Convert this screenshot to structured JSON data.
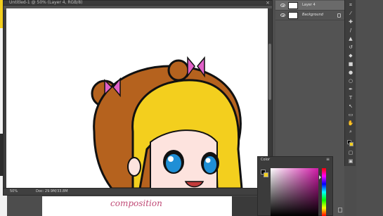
{
  "document": {
    "title": "Untitled-1 @ 50% (Layer 4, RGB/8)",
    "zoom": "50%",
    "info": "Doc: 29.9M/33.8M"
  },
  "layers": [
    {
      "name": "Layer 4",
      "italic": false,
      "active": true
    },
    {
      "name": "Background",
      "italic": true,
      "active": false,
      "locked": true
    }
  ],
  "color_panel": {
    "title": "Color",
    "foreground": "#000000",
    "background": "#f3cf1e",
    "selected_hue": "#d21aa8"
  },
  "handwriting": "composition",
  "tools": [
    "crop-icon",
    "eyedropper-icon",
    "healing-icon",
    "brush-icon",
    "stamp-icon",
    "history-brush-icon",
    "eraser-icon",
    "gradient-icon",
    "blur-icon",
    "dodge-icon",
    "pen-icon",
    "type-icon",
    "path-select-icon",
    "shape-icon",
    "hand-icon",
    "zoom-icon",
    "more-icon"
  ],
  "colors": {
    "skin": "#fde3de",
    "hair_yellow": "#f3cf1e",
    "hair_brown": "#b5621e",
    "bow_pink": "#e060c8",
    "eye_blue": "#1f8fd6"
  }
}
